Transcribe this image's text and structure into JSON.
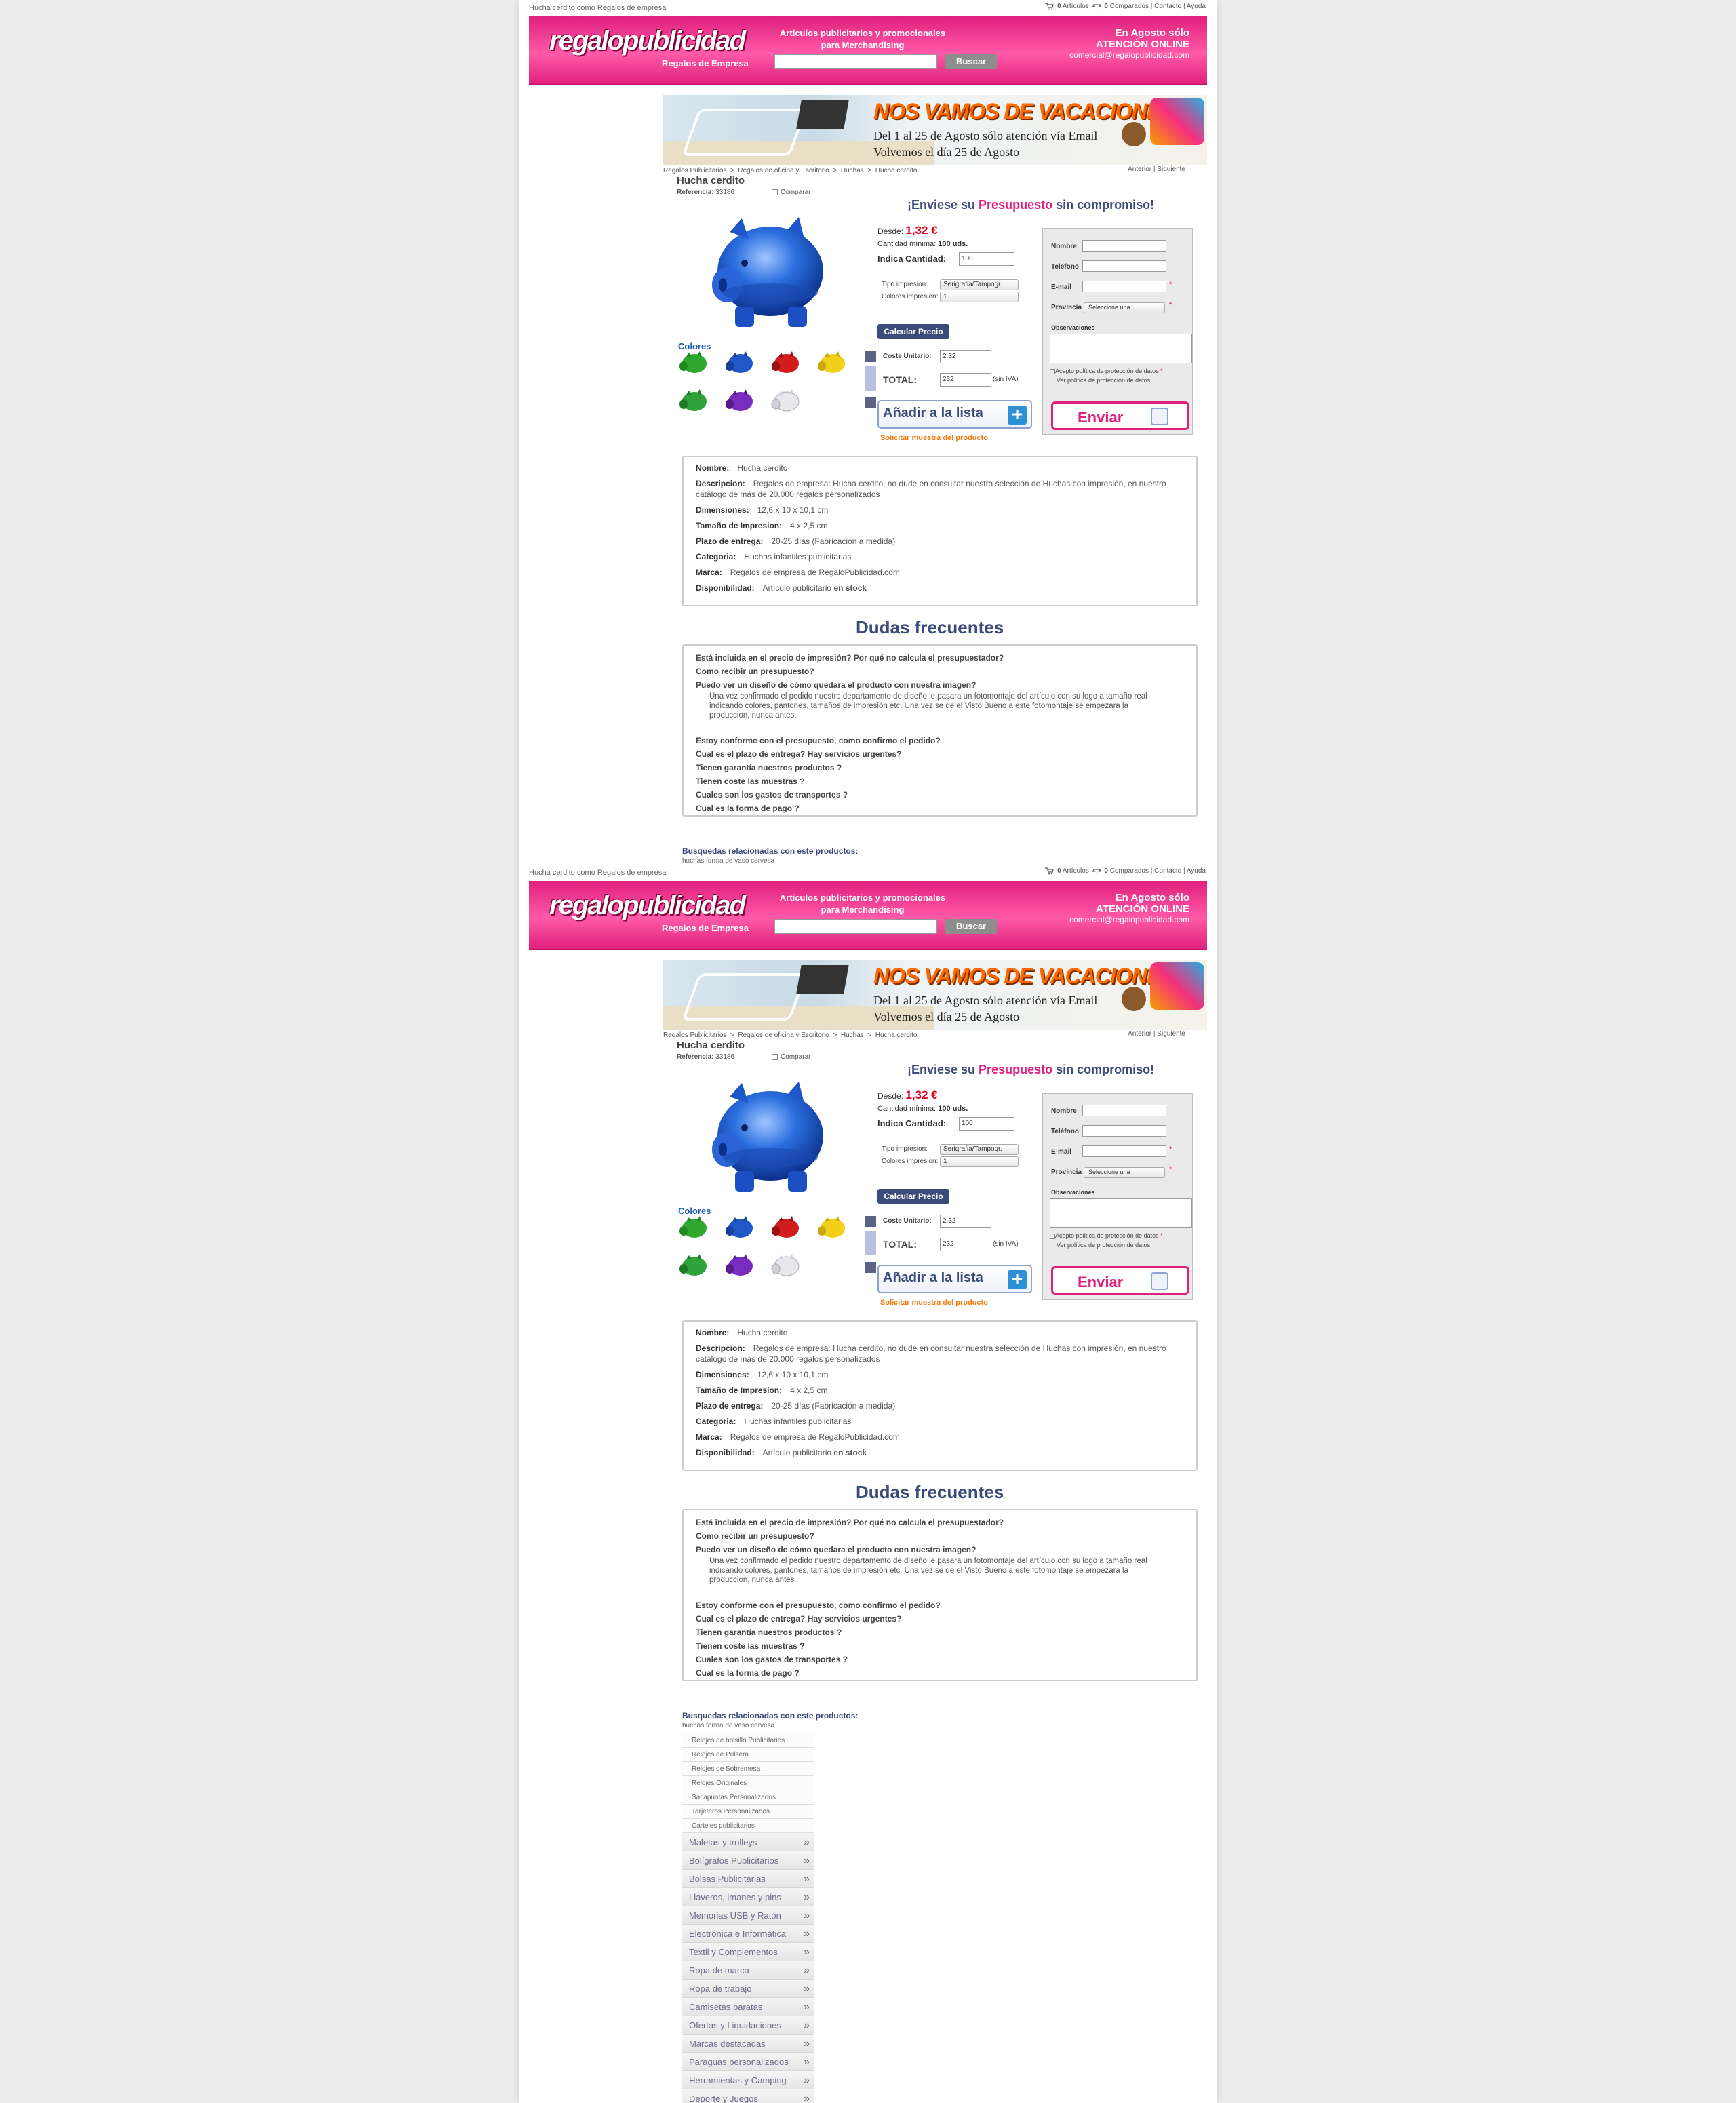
{
  "top": {
    "page_title": "Hucha cerdito como Regalos de empresa",
    "articulos_count": "0",
    "articulos_label": "Artículos",
    "comparados_count": "0",
    "comparados_label": "Comparados",
    "contacto": "Contacto",
    "ayuda": "Ayuda",
    "separator": "|"
  },
  "header": {
    "logo": "regalopublicidad",
    "logo_sub": "Regalos de Empresa",
    "tagline_1": "Artículos publicitarios y promocionales",
    "tagline_2": "para Merchandising",
    "search_placeholder": "",
    "search_button": "Buscar",
    "right_1": "En Agosto sólo",
    "right_2": "ATENCIÓN ONLINE",
    "right_3": "comercial@regalopublicidad.com",
    "brand_color": "#e0207d"
  },
  "banner": {
    "title": "NOS VAMOS DE VACACIONES!",
    "line_2": "Del 1 al 25 de Agosto sólo atención vía Email",
    "line_3": "Volvemos el día 25 de Agosto"
  },
  "breadcrumb": {
    "items": [
      "Regalos Publicitarios",
      "Regalos de oficina y Escritorio",
      "Huchas",
      "Hucha cerdito"
    ],
    "separator": ">",
    "anterior": "Anterior",
    "siguiente": "Siguiente"
  },
  "product": {
    "title": "Hucha cerdito",
    "ref_label": "Referencia:",
    "ref_value": "33186",
    "compare_label": "Comparar",
    "colores_label": "Colores",
    "swatches": [
      "green",
      "blue",
      "red",
      "yellow",
      "green",
      "purple",
      "clear"
    ]
  },
  "pricing": {
    "quote_prefix": "¡Enviese su ",
    "quote_highlight": "Presupuesto",
    "quote_suffix": " sin compromiso!",
    "desde_label": "Desde:",
    "price": "1,32 €",
    "min_label": "Cantidad mínima:",
    "min_value": "100 uds.",
    "indica_label": "Indica Cantidad:",
    "qty_value": "100",
    "tipo_label": "Tipo impresion:",
    "tipo_value": "Serigrafia/Tampogr.",
    "colores_label": "Colores impresion:",
    "colores_value": "1",
    "calc_button": "Calcular Precio",
    "coste_label": "Coste Unitario:",
    "coste_value": "2.32",
    "total_label": "TOTAL:",
    "total_value": "232",
    "sin_iva": "(sin IVA)",
    "add_button": "Añadir a la lista",
    "sample_link": "Solicitar muestra del producto"
  },
  "form": {
    "nombre": "Nombre",
    "telefono": "Teléfono",
    "email": "E-mail",
    "provincia": "Provincia",
    "provincia_value": "Seleccione una",
    "required": "*",
    "observaciones": "Observaciones",
    "accept": "Acepto política de protección de datos",
    "privacy_link": "Ver política de protección de datos",
    "send_button": "Enviar"
  },
  "details": {
    "nombre_label": "Nombre:",
    "nombre_value": "Hucha cerdito",
    "descripcion_label": "Descripcion:",
    "descripcion_value": "Regalos de empresa: Hucha cerdito, no dude en consultar nuestra selección de Huchas con impresión, en nuestro catálogo de más de 20.000 regalos personalizados",
    "dimensiones_label": "Dimensiones:",
    "dimensiones_value": "12,6 x 10 x 10,1 cm",
    "tamano_label": "Tamaño de Impresion:",
    "tamano_value": "4 x 2,5 cm",
    "plazo_label": "Plazo de entrega:",
    "plazo_value": "20-25 días (Fabricación a medida)",
    "categoria_label": "Categoria:",
    "categoria_value": "Huchas infantiles publicitarias",
    "marca_label": "Marca:",
    "marca_value": "Regalos de empresa de RegaloPublicidad.com",
    "disp_label": "Disponibilidad:",
    "disp_value": "Artículo publicitario ",
    "disp_bold": "en stock"
  },
  "faq": {
    "title": "Dudas frecuentes",
    "q1": "Está incluida en el precio de impresión? Por qué no calcula el presupuestador?",
    "q2": "Como recibir un presupuesto?",
    "q3": "Puedo ver un diseño de cómo quedara el producto con nuestra imagen?",
    "a3": "Una vez confirmado el pedido nuestro departamento de diseño le pasara un fotomontaje del artículo con su logo a tamaño real indicando colores, pantones, tamaños de impresión etc. Una vez se de el Visto Bueno a este fotomontaje se empezara la produccion, nunca antes.",
    "q4": "Estoy conforme con el presupuesto, como confirmo el pedido?",
    "q5": "Cual es el plazo de entrega? Hay servicios urgentes?",
    "q6": "Tienen garantía nuestros productos ?",
    "q7": "Tienen coste las muestras ?",
    "q8": "Cuales son los gastos de transportes ?",
    "q9": "Cual es la forma de pago ?"
  },
  "related": {
    "title": "Busquedas relacionadas con este productos:",
    "first": "huchas forma de vaso cervesa"
  },
  "submenu": [
    "Relojes de bolsillo Publicitarios",
    "Relojes de Pulsera",
    "Relojes de Sobremesa",
    "Relojes Originales",
    "Sacapuntas Personalizados",
    "Tarjeteros Personalizados",
    "Carteles publicitarios"
  ],
  "categories": [
    "Maletas y trolleys",
    "Bolígrafos Publicitarios",
    "Bolsas Publicitarias",
    "Llaveros, imanes y pins",
    "Memorias USB y Ratón",
    "Electrónica e Informática",
    "Textil y Complementos",
    "Ropa de marca",
    "Ropa de trabajo",
    "Camisetas baratas",
    "Ofertas y Liquidaciones",
    "Marcas destacadas",
    "Paraguas personalizados",
    "Herramientas y Camping",
    "Deporte y Juegos"
  ],
  "category_arrow": "»"
}
